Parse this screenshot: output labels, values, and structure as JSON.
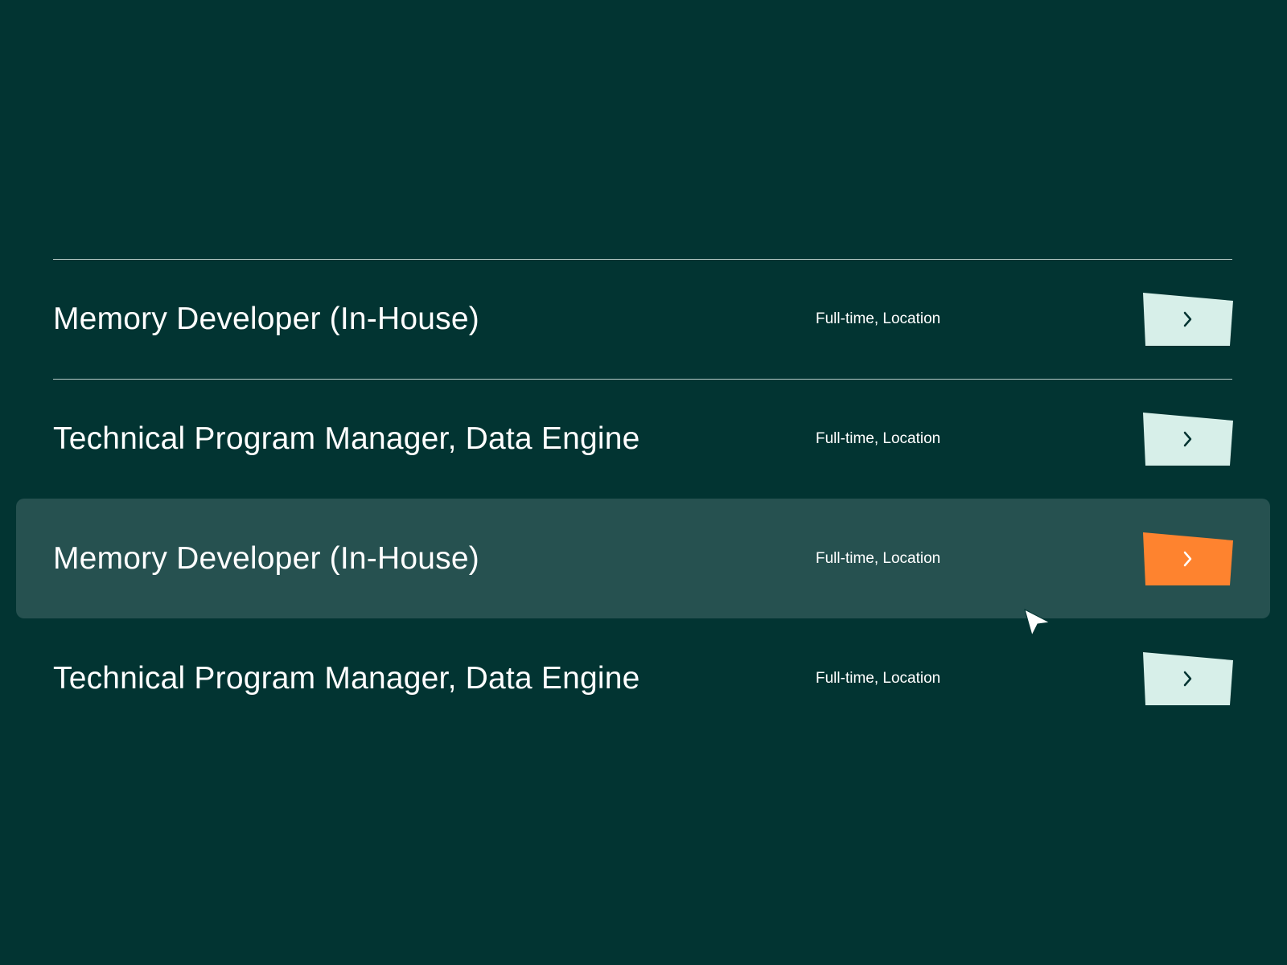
{
  "jobs": [
    {
      "title": "Memory Developer (In-House)",
      "meta": "Full-time, Location",
      "highlighted": false
    },
    {
      "title": "Technical Program Manager, Data Engine",
      "meta": "Full-time, Location",
      "highlighted": false
    },
    {
      "title": "Memory Developer (In-House)",
      "meta": "Full-time, Location",
      "highlighted": true
    },
    {
      "title": "Technical Program Manager, Data Engine",
      "meta": "Full-time, Location",
      "highlighted": false
    }
  ],
  "icons": {
    "row_action": "chevron-right-icon",
    "pointer": "mouse-pointer-icon"
  },
  "colors": {
    "background": "#023432",
    "highlight_row": "#265150",
    "divider": "#b8ccc8",
    "button": "#d7efe9",
    "button_active": "#fe832f",
    "chevron": "#033432",
    "chevron_active": "#ffffff",
    "text": "#ffffff"
  }
}
